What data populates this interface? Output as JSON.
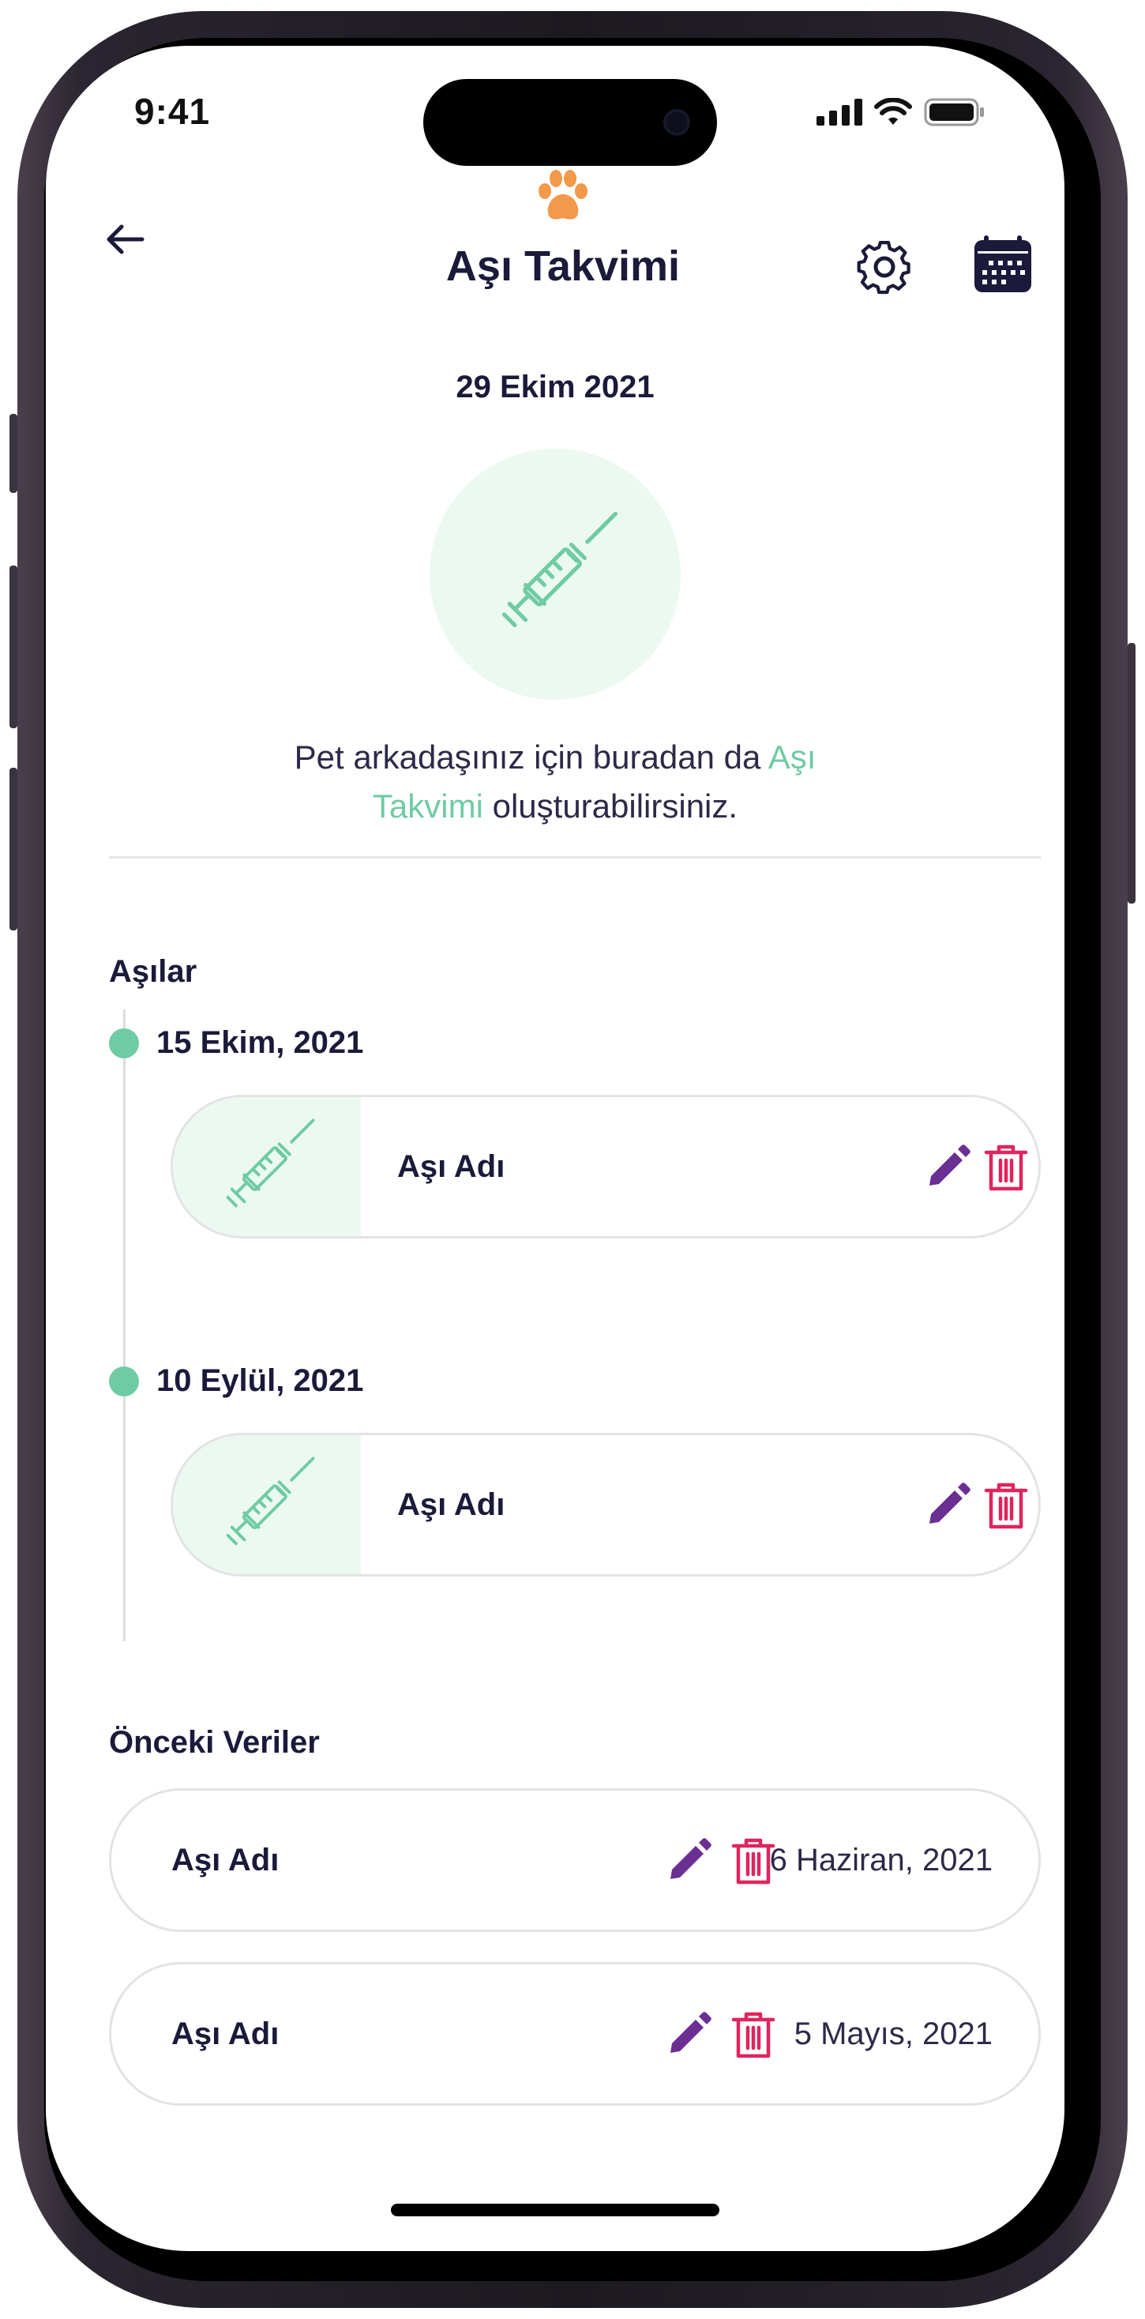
{
  "status_bar": {
    "time": "9:41"
  },
  "header": {
    "title": "Aşı Takvimi"
  },
  "hero": {
    "date": "29 Ekim 2021",
    "text_part1": "Pet arkadaşınız için buradan da ",
    "text_accent": "Aşı Takvimi",
    "text_part2": " oluşturabilirsiniz."
  },
  "vaccines": {
    "section_title": "Aşılar",
    "items": [
      {
        "date": "15 Ekim, 2021",
        "name": "Aşı Adı"
      },
      {
        "date": "10 Eylül, 2021",
        "name": "Aşı Adı"
      }
    ]
  },
  "previous": {
    "section_title": "Önceki Veriler",
    "items": [
      {
        "name": "Aşı Adı",
        "date": "6 Haziran, 2021"
      },
      {
        "name": "Aşı Adı",
        "date": "5 Mayıs, 2021"
      }
    ]
  },
  "icons": {
    "back": "arrow-left-icon",
    "logo": "paw-icon",
    "settings": "gear-icon",
    "calendar": "calendar-icon",
    "syringe": "syringe-icon",
    "edit": "pencil-icon",
    "delete": "trash-icon"
  },
  "colors": {
    "accent_green": "#6fcba4",
    "light_green": "#ebf9f1",
    "edit_purple": "#6b2f92",
    "delete_red": "#e0245e",
    "paw_orange": "#f2994a",
    "text_dark": "#1b1a3a"
  }
}
